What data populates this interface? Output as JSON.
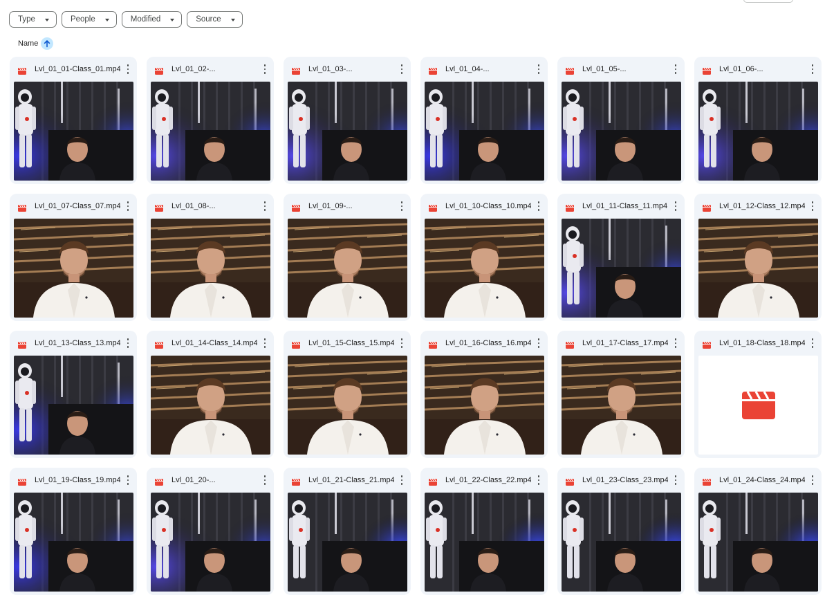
{
  "filters": [
    {
      "label": "Type"
    },
    {
      "label": "People"
    },
    {
      "label": "Modified"
    },
    {
      "label": "Source"
    }
  ],
  "sort": {
    "label": "Name",
    "direction": "ascending",
    "icon": "arrow-up-icon"
  },
  "colors": {
    "accent": "#0b57d0",
    "video_icon": "#ea4335",
    "card_bg": "#f0f4f9",
    "sort_bg": "#c2e7ff"
  },
  "files": [
    {
      "name": "Lvl_01_01-Class_01.mp4",
      "scene": "astronaut"
    },
    {
      "name": "Lvl_01_02-...",
      "scene": "astronaut"
    },
    {
      "name": "Lvl_01_03-...",
      "scene": "astronaut"
    },
    {
      "name": "Lvl_01_04-...",
      "scene": "astronaut"
    },
    {
      "name": "Lvl_01_05-...",
      "scene": "astronaut"
    },
    {
      "name": "Lvl_01_06-...",
      "scene": "astronaut"
    },
    {
      "name": "Lvl_01_07-Class_07.mp4",
      "scene": "studio"
    },
    {
      "name": "Lvl_01_08-...",
      "scene": "studio"
    },
    {
      "name": "Lvl_01_09-...",
      "scene": "studio"
    },
    {
      "name": "Lvl_01_10-Class_10.mp4",
      "scene": "studio"
    },
    {
      "name": "Lvl_01_11-Class_11.mp4",
      "scene": "astronaut"
    },
    {
      "name": "Lvl_01_12-Class_12.mp4",
      "scene": "studio"
    },
    {
      "name": "Lvl_01_13-Class_13.mp4",
      "scene": "astronaut"
    },
    {
      "name": "Lvl_01_14-Class_14.mp4",
      "scene": "studio"
    },
    {
      "name": "Lvl_01_15-Class_15.mp4",
      "scene": "studio"
    },
    {
      "name": "Lvl_01_16-Class_16.mp4",
      "scene": "studio"
    },
    {
      "name": "Lvl_01_17-Class_17.mp4",
      "scene": "studio"
    },
    {
      "name": "Lvl_01_18-Class_18.mp4",
      "scene": "none"
    },
    {
      "name": "Lvl_01_19-Class_19.mp4",
      "scene": "astronaut"
    },
    {
      "name": "Lvl_01_20-...",
      "scene": "astronaut"
    },
    {
      "name": "Lvl_01_21-Class_21.mp4",
      "scene": "astronaut"
    },
    {
      "name": "Lvl_01_22-Class_22.mp4",
      "scene": "astronaut"
    },
    {
      "name": "Lvl_01_23-Class_23.mp4",
      "scene": "astronaut"
    },
    {
      "name": "Lvl_01_24-Class_24.mp4",
      "scene": "astronaut"
    }
  ]
}
